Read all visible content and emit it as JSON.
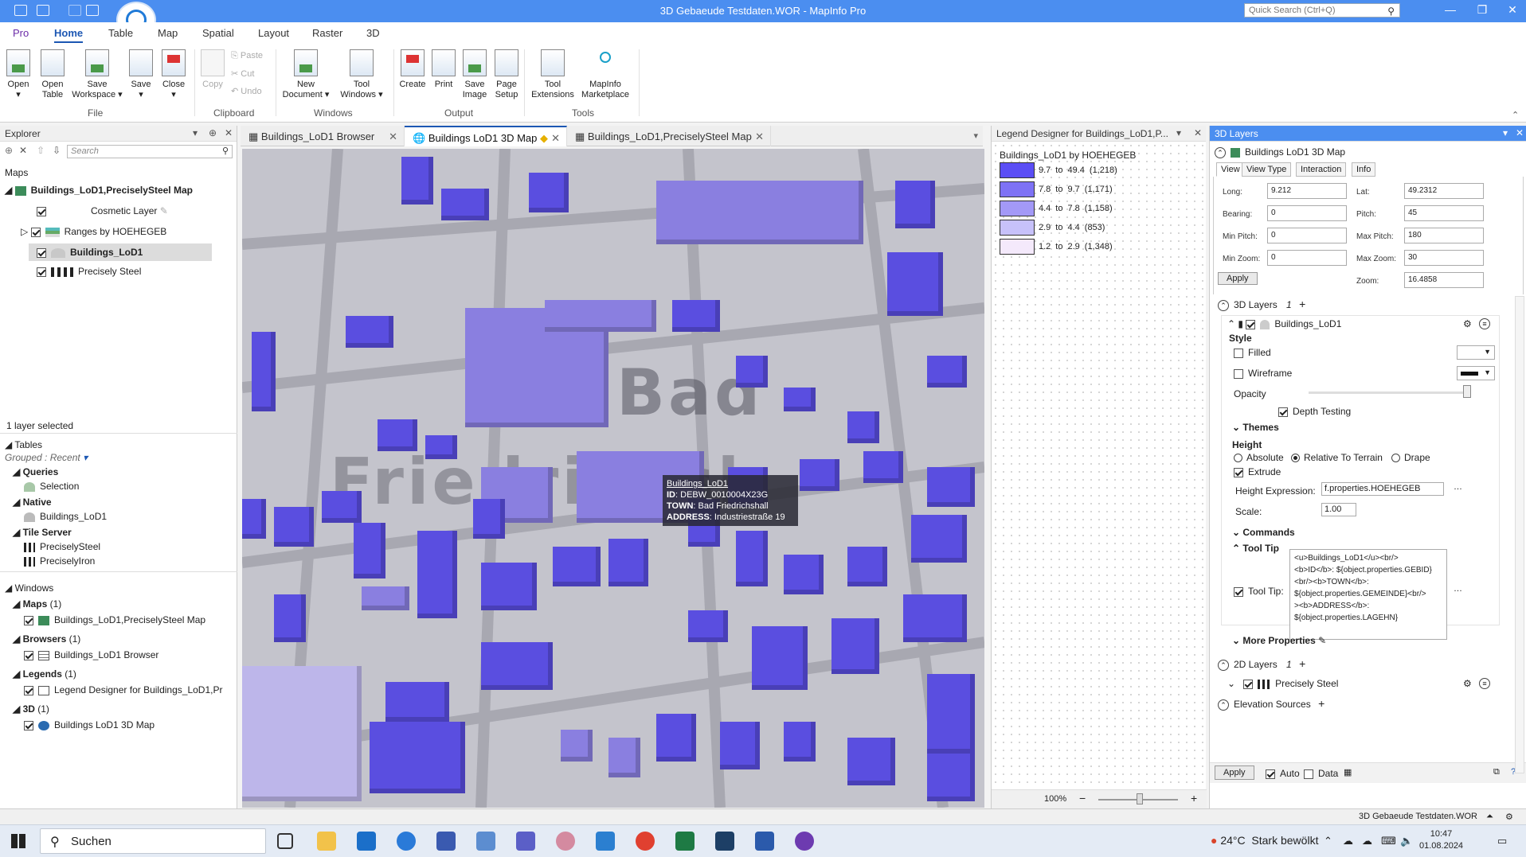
{
  "app": {
    "title": "3D Gebaeude Testdaten.WOR - MapInfo Pro",
    "quick_search_placeholder": "Quick Search (Ctrl+Q)"
  },
  "ribbon_tabs": [
    "Pro",
    "Home",
    "Table",
    "Map",
    "Spatial",
    "Layout",
    "Raster",
    "3D"
  ],
  "ribbon": {
    "file": {
      "label": "File",
      "buttons": [
        {
          "label": "Open",
          "sub": ""
        },
        {
          "label": "Open",
          "sub": "Table"
        },
        {
          "label": "Save",
          "sub": "Workspace"
        },
        {
          "label": "Save",
          "sub": ""
        },
        {
          "label": "Close",
          "sub": ""
        }
      ]
    },
    "clipboard": {
      "label": "Clipboard",
      "copy": "Copy",
      "paste": "Paste",
      "cut": "Cut",
      "undo": "Undo"
    },
    "windows": {
      "label": "Windows",
      "new_document": "New",
      "new_document_sub": "Document",
      "tool_windows": "Tool",
      "tool_windows_sub": "Windows"
    },
    "output": {
      "label": "Output",
      "create": "Create",
      "print": "Print",
      "save_image": "Save",
      "save_image_sub": "Image",
      "page_setup": "Page",
      "page_setup_sub": "Setup"
    },
    "tools": {
      "label": "Tools",
      "tool_ext": "Tool",
      "tool_ext_sub": "Extensions",
      "marketplace": "MapInfo",
      "marketplace_sub": "Marketplace"
    }
  },
  "explorer": {
    "title": "Explorer",
    "search_placeholder": "Search",
    "maps_header": "Maps",
    "map_name": "Buildings_LoD1,PreciselySteel Map",
    "layers": [
      "Cosmetic Layer",
      "Ranges by HOEHEGEB",
      "Buildings_LoD1",
      "Precisely Steel"
    ],
    "selection_status": "1 layer selected",
    "tables_header": "Tables",
    "grouped": "Grouped : Recent",
    "queries_header": "Queries",
    "queries": [
      "Selection"
    ],
    "native_header": "Native",
    "native": [
      "Buildings_LoD1"
    ],
    "tile_header": "Tile Server",
    "tiles": [
      "PreciselySteel",
      "PreciselyIron"
    ],
    "windows_header": "Windows",
    "win_maps": "Maps",
    "win_maps_count": "(1)",
    "win_maps_item": "Buildings_LoD1,PreciselySteel Map",
    "win_browsers": "Browsers",
    "win_browsers_count": "(1)",
    "win_browsers_item": "Buildings_LoD1 Browser",
    "win_legends": "Legends",
    "win_legends_count": "(1)",
    "win_legends_item": "Legend Designer for Buildings_LoD1,Pr",
    "win_3d": "3D",
    "win_3d_count": "(1)",
    "win_3d_item": "Buildings LoD1 3D Map"
  },
  "doc_tabs": [
    "Buildings_LoD1 Browser",
    "Buildings LoD1 3D Map",
    "Buildings_LoD1,PreciselySteel Map"
  ],
  "map": {
    "label_1": "Bad",
    "label_2": "Friedrichsh",
    "tooltip": {
      "name": "Buildings_LoD1",
      "id_label": "ID",
      "id_value": "DEBW_0010004X23G",
      "town_label": "TOWN",
      "town_value": "Bad Friedrichshall",
      "address_label": "ADDRESS",
      "address_value": "Industriestraße 19"
    }
  },
  "legend": {
    "panel_title": "Legend Designer for Buildings_LoD1,P...",
    "title": "Buildings_LoD1 by HOEHEGEB",
    "rows": [
      {
        "from": "9.7",
        "to": "49.4",
        "count": "(1,218)",
        "color": "#5b4ef5"
      },
      {
        "from": "7.8",
        "to": "9.7",
        "count": "(1,171)",
        "color": "#7e72f5"
      },
      {
        "from": "4.4",
        "to": "7.8",
        "count": "(1,158)",
        "color": "#a399f7"
      },
      {
        "from": "2.9",
        "to": "4.4",
        "count": "(853)",
        "color": "#c7c1fa"
      },
      {
        "from": "1.2",
        "to": "2.9",
        "count": "(1,348)",
        "color": "#f4e9fb"
      }
    ],
    "to_word": "to",
    "zoom": "100%"
  },
  "layers3d": {
    "panel_title": "3D Layers",
    "map_name": "Buildings LoD1 3D Map",
    "tabs": [
      "View",
      "View Type",
      "Interaction",
      "Info"
    ],
    "fields": {
      "long_label": "Long:",
      "long": "9.212",
      "lat_label": "Lat:",
      "lat": "49.2312",
      "bearing_label": "Bearing:",
      "bearing": "0",
      "pitch_label": "Pitch:",
      "pitch": "45",
      "min_pitch_label": "Min Pitch:",
      "min_pitch": "0",
      "max_pitch_label": "Max Pitch:",
      "max_pitch": "180",
      "min_zoom_label": "Min Zoom:",
      "min_zoom": "0",
      "max_zoom_label": "Max Zoom:",
      "max_zoom": "30",
      "zoom_label": "Zoom:",
      "zoom": "16.4858"
    },
    "apply": "Apply",
    "section_3d": "3D Layers",
    "section_3d_count": "1",
    "layer_name": "Buildings_LoD1",
    "style": "Style",
    "filled": "Filled",
    "wireframe": "Wireframe",
    "opacity": "Opacity",
    "opacity_value": 1.0,
    "depth_testing": "Depth Testing",
    "themes": "Themes",
    "height": "Height",
    "absolute": "Absolute",
    "relative": "Relative To Terrain",
    "drape": "Drape",
    "extrude": "Extrude",
    "height_expr_label": "Height Expression:",
    "height_expr": "f.properties.HOEHEGEB",
    "scale_label": "Scale:",
    "scale": "1.00",
    "commands": "Commands",
    "tool_tip_header": "Tool Tip",
    "tool_tip_label": "Tool Tip:",
    "tool_tip_text": "<u>Buildings_LoD1</u><br/>\n<b>ID</b>: ${object.properties.GEBID}<br/><b>TOWN</b>:\n${object.properties.GEMEINDE}<br/>\n><b>ADDRESS</b>:\n${object.properties.LAGEHN}",
    "more_props": "More Properties",
    "section_2d": "2D Layers",
    "section_2d_count": "1",
    "layer_2d": "Precisely Steel",
    "elevation": "Elevation Sources",
    "bottom_apply": "Apply",
    "auto": "Auto",
    "data": "Data"
  },
  "statusbar": {
    "workspace": "3D Gebaeude Testdaten.WOR"
  },
  "taskbar": {
    "search": "Suchen",
    "weather_temp": "24°C",
    "weather_text": "Stark bewölkt",
    "time": "10:47",
    "date": "01.08.2024"
  },
  "colors": {
    "accent": "#4b8ef0",
    "building_dark": "#5a4ee0",
    "building_light": "#8a7fe0",
    "building_pale": "#bdb6ea"
  }
}
